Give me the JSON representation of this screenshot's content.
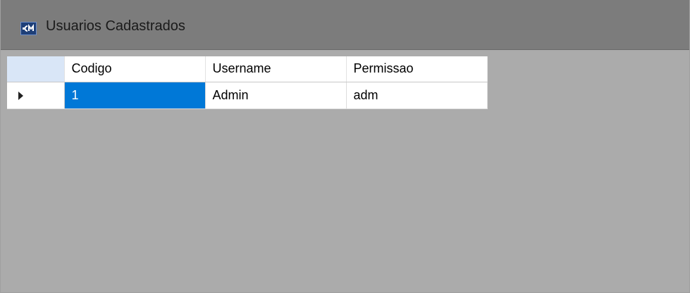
{
  "window": {
    "title": "Usuarios Cadastrados",
    "icon": "app-logo-icon"
  },
  "table": {
    "columns": [
      "Codigo",
      "Username",
      "Permissao"
    ],
    "rows": [
      {
        "codigo": "1",
        "username": "Admin",
        "permissao": "adm",
        "current": true,
        "selected_cell": "codigo"
      }
    ]
  },
  "colors": {
    "titlebar": "#7c7c7c",
    "background": "#ababab",
    "selection": "#0078d7",
    "corner_header": "#d9e6f7"
  }
}
